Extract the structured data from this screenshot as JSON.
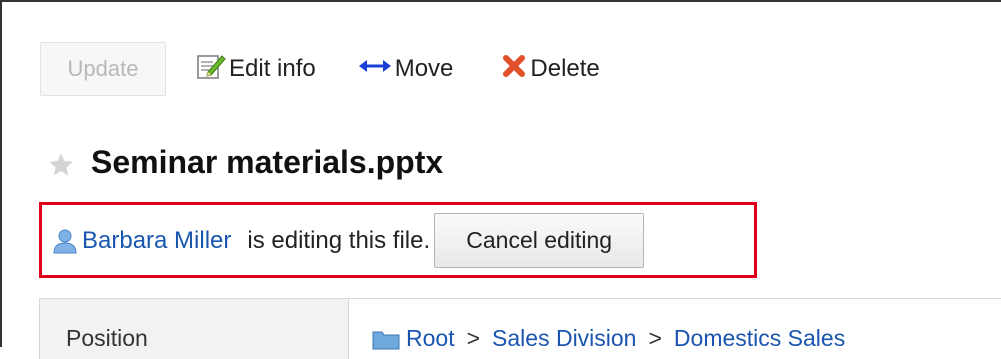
{
  "toolbar": {
    "update_label": "Update",
    "edit_info_label": "Edit info",
    "move_label": "Move",
    "delete_label": "Delete"
  },
  "file": {
    "title": "Seminar materials.pptx"
  },
  "editing_notice": {
    "user_name": "Barbara Miller",
    "message": "is editing this file.",
    "cancel_label": "Cancel editing"
  },
  "properties": {
    "position_label": "Position",
    "path": [
      "Root",
      "Sales Division",
      "Domestics Sales"
    ],
    "separator": ">"
  },
  "colors": {
    "link": "#1a56b0",
    "highlight_border": "#e0001b",
    "move_arrow": "#1a3fd6",
    "delete_x": "#e0502a"
  }
}
